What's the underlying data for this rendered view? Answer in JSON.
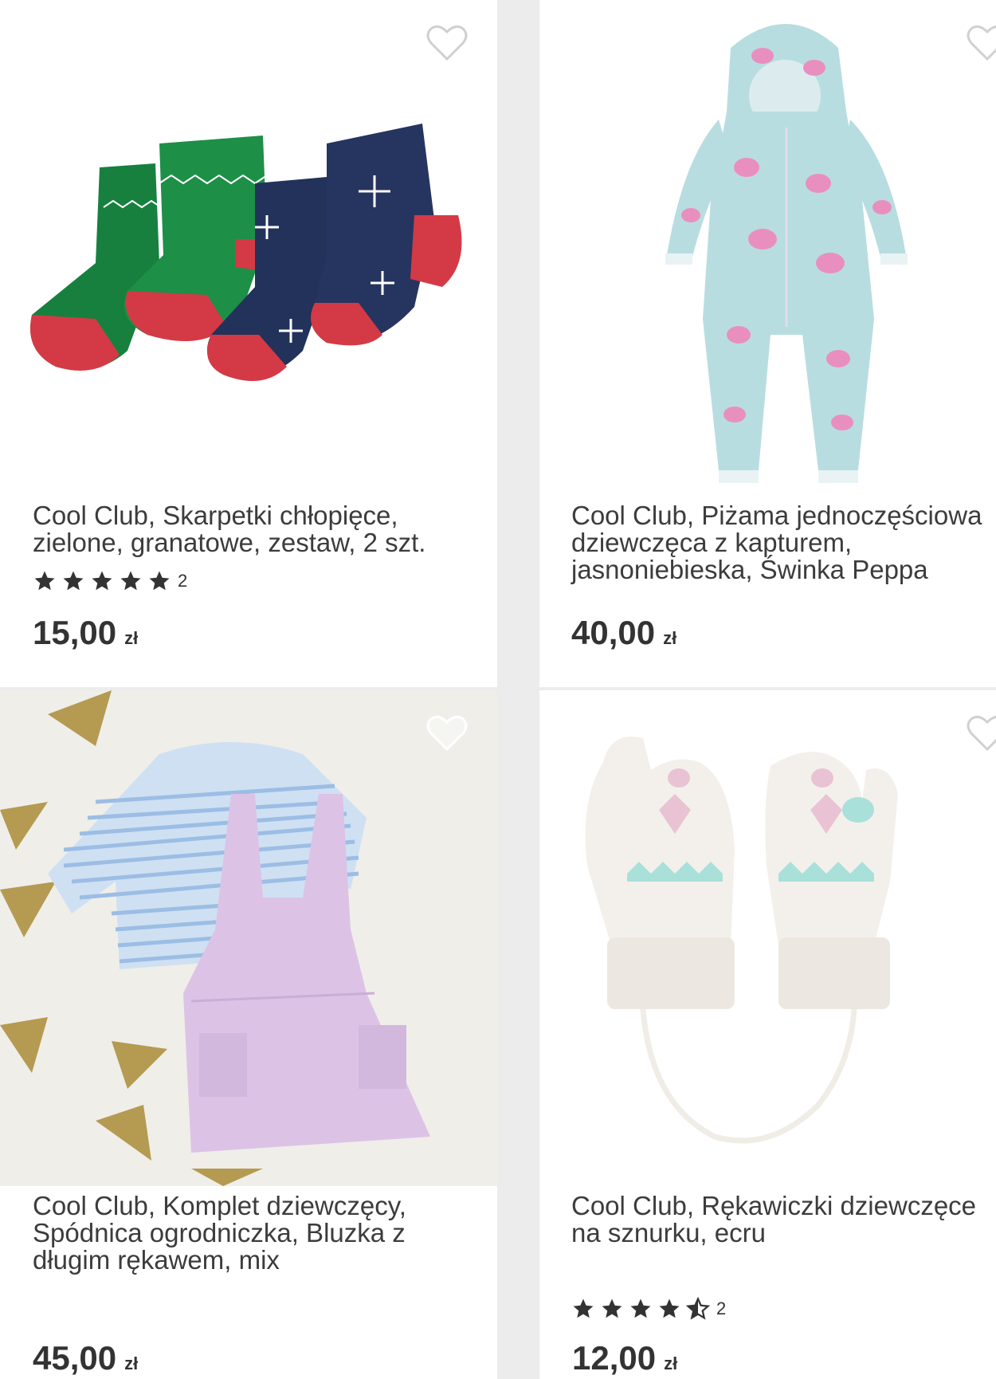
{
  "products": [
    {
      "title": "Cool Club, Skarpetki chłopięce, zielone, granatowe, zestaw, 2 szt.",
      "rating_count": "2",
      "rating": 5,
      "price": "15,00",
      "currency": "zł"
    },
    {
      "title": "Cool Club, Piżama jednoczęściowa dziewczęca z kapturem, jasnoniebieska, Świnka Peppa",
      "price": "40,00",
      "currency": "zł"
    },
    {
      "title": "Cool Club, Komplet dziewczęcy, Spódnica ogrodniczka, Bluzka z długim rękawem, mix",
      "price": "45,00",
      "currency": "zł"
    },
    {
      "title": "Cool Club, Rękawiczki dziewczęce na sznurku, ecru",
      "rating_count": "2",
      "rating": 4.5,
      "price": "12,00",
      "currency": "zł"
    }
  ],
  "icons": {
    "favorite": "heart-outline-icon",
    "star": "star-icon"
  },
  "colors": {
    "text": "#3c3c3c",
    "star": "#333333",
    "heart": "#d0d0d0"
  }
}
